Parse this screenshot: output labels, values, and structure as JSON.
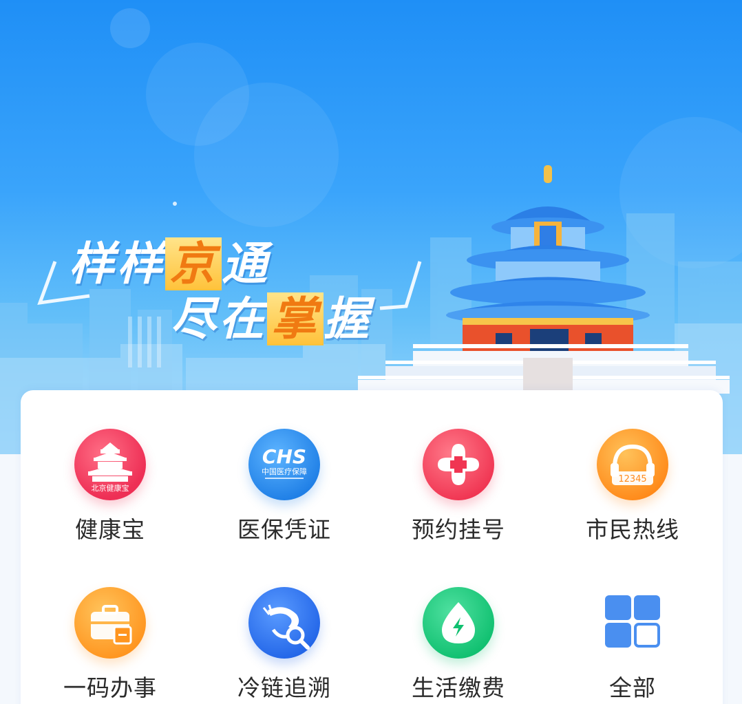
{
  "banner": {
    "slogan_line1_a": "样样",
    "slogan_line1_hl": "京",
    "slogan_line1_b": "通",
    "slogan_line2_a": "尽在",
    "slogan_line2_hl": "掌",
    "slogan_line2_b": "握"
  },
  "services": [
    {
      "label": "健康宝",
      "icon": "beijing-health-kit-icon",
      "icon_text": "北京健康宝",
      "color": "#f0385a"
    },
    {
      "label": "医保凭证",
      "icon": "chs-medical-insurance-icon",
      "icon_text": "中国医疗保障",
      "icon_title": "CHS",
      "color": "#2f8ef0"
    },
    {
      "label": "预约挂号",
      "icon": "medical-cross-icon",
      "color": "#f4405a"
    },
    {
      "label": "市民热线",
      "icon": "hotline-headset-icon",
      "icon_text": "12345",
      "color": "#ff9a1f"
    },
    {
      "label": "一码办事",
      "icon": "briefcase-scan-icon",
      "color": "#ffa31f"
    },
    {
      "label": "冷链追溯",
      "icon": "shrimp-search-icon",
      "color": "#2f7ef2"
    },
    {
      "label": "生活缴费",
      "icon": "water-drop-lightning-icon",
      "color": "#17c97a"
    },
    {
      "label": "全部",
      "icon": "grid-all-icon",
      "color": "#4a90f0"
    }
  ]
}
